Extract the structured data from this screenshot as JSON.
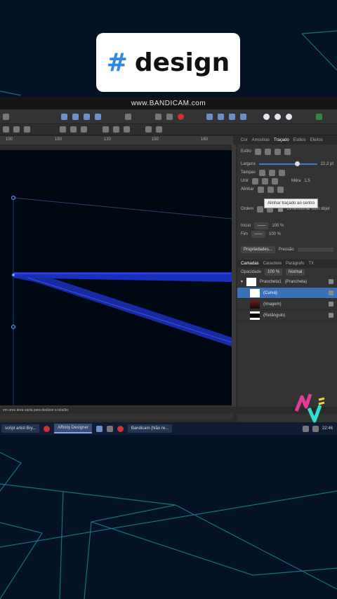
{
  "overlay": {
    "hash_symbol": "#",
    "word": "design"
  },
  "recorder": {
    "watermark": "www.BANDICAM.com"
  },
  "ruler": {
    "marks": [
      "100",
      "150",
      "130",
      "150",
      "160"
    ]
  },
  "panel": {
    "tabs": [
      "Cor",
      "Amostras",
      "Traçado",
      "Estilos",
      "Efeitos"
    ],
    "active_tab": "Traçado",
    "style_label": "Estilo",
    "width_label": "Largura",
    "width_value": "22,2 pt",
    "cap_label": "Tampas",
    "join_label": "Unir",
    "miter_label": "Mitra",
    "miter_value": "1,5",
    "align_label": "Alinhar",
    "tooltip": "Alinhar traçado ao centro",
    "order_label": "Ordem",
    "order_hint": "Dimensionar com objet",
    "start_label": "Início",
    "end_label": "Fim",
    "start_value": "100 %",
    "end_value": "100 %",
    "properties_button": "Propriedades...",
    "pressure_label": "Pressão"
  },
  "layers_panel": {
    "tabs": [
      "Camadas",
      "Caractere",
      "Parágrafo",
      "TX"
    ],
    "opacity_label": "Opacidade",
    "opacity_value": "100 %",
    "blend_mode": "Normal",
    "layers": [
      {
        "name": "Prancheta1",
        "suffix": "(Prancheta)",
        "thumb": "white"
      },
      {
        "name": "(Curva)",
        "suffix": "",
        "thumb": "white",
        "selected": true
      },
      {
        "name": "(Imagem)",
        "suffix": "",
        "thumb": "image"
      },
      {
        "name": "(Retângulo)",
        "suffix": "",
        "thumb": "black"
      }
    ]
  },
  "status": {
    "hint": "em uma área vazia para deslizar a tela/ão."
  },
  "taskbar": {
    "items": [
      "script artist Bry...",
      "Affinity Designer",
      "Bandicam (Não re..."
    ],
    "clock": "22:46"
  },
  "colors": {
    "accent": "#3b6fb6",
    "stroke_blue": "#1c32c8",
    "background": "#031224"
  },
  "icons": [
    "hash-icon",
    "bandicam-record-icon",
    "windows-start-icon",
    "clock-icon"
  ]
}
